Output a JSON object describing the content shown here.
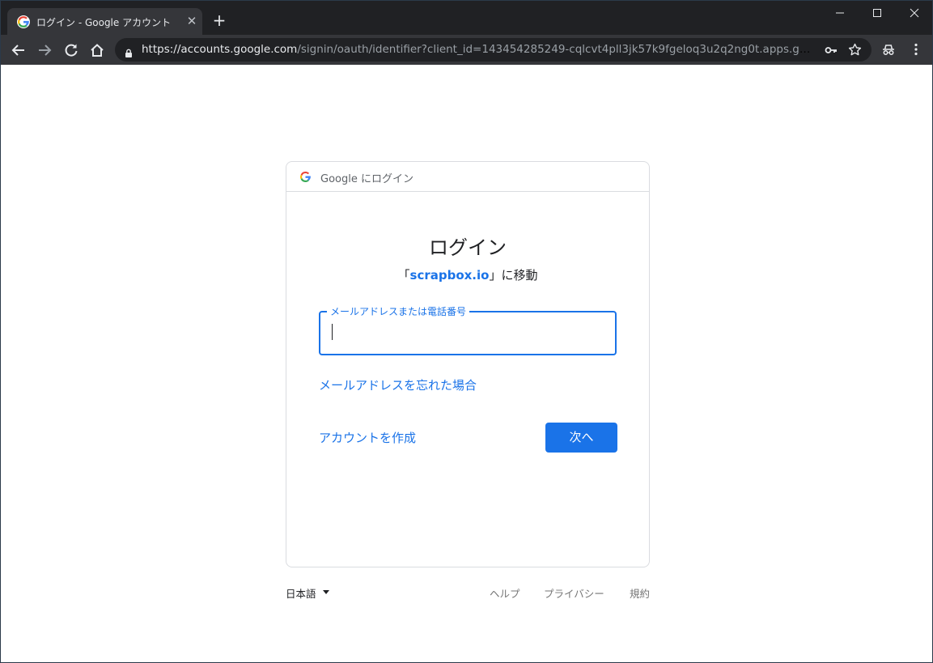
{
  "browser": {
    "tab_title": "ログイン - Google アカウント",
    "close_glyph": "✕",
    "newtab_glyph": "+",
    "url_host": "https://accounts.google.com",
    "url_path": "/signin/oauth/identifier?client_id=143454285249-cqlcvt4pll3jk57k9fgeloq3u2q2ng0t.apps.googleuserco..."
  },
  "card": {
    "header_text": "Google にログイン",
    "heading": "ログイン",
    "sub_prefix": "「",
    "sub_link": "scrapbox.io",
    "sub_suffix": "」に移動",
    "email_label": "メールアドレスまたは電話番号",
    "email_value": "",
    "forgot_link": "メールアドレスを忘れた場合",
    "create_account": "アカウントを作成",
    "next_button": "次へ"
  },
  "footer": {
    "language": "日本語",
    "help": "ヘルプ",
    "privacy": "プライバシー",
    "terms": "規約"
  },
  "colors": {
    "accent": "#1a73e8",
    "chrome_dark": "#202124",
    "chrome_mid": "#35363a"
  }
}
